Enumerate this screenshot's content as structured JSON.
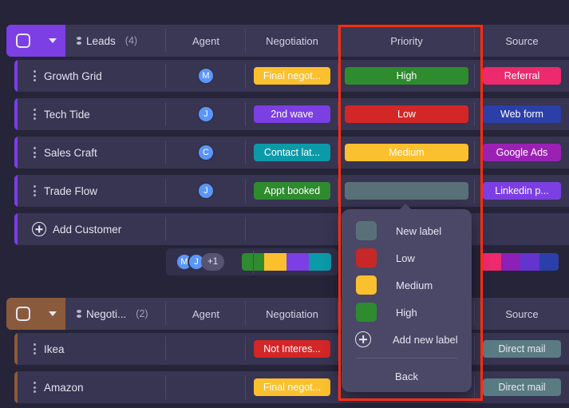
{
  "theme": {
    "page_bg": "#262438",
    "row_bg": "#373552",
    "header_bg": "#3a3855",
    "divider": "#4a4862",
    "annotation_color": "#ff2d10"
  },
  "annotation": {
    "name": "priority-column-highlight",
    "label": "Priority column highlight"
  },
  "tables": [
    {
      "id": "leads",
      "group_color": "#7b3fe4",
      "header": {
        "checkbox": "checkbox-icon",
        "chevron": "chevron-down-icon",
        "title": "Leads",
        "count": "(4)",
        "columns": [
          "Agent",
          "Negotiation",
          "Priority",
          "Source"
        ]
      },
      "rows": [
        {
          "name": "Growth Grid",
          "agent": {
            "initial": "M",
            "color": "#5b96f7"
          },
          "negotiation": {
            "label": "Final negot...",
            "color": "#fbc02d",
            "text_color": "#fff"
          },
          "priority": {
            "label": "High",
            "color": "#2e8b2e",
            "text_color": "#fff"
          },
          "source": {
            "label": "Referral",
            "color": "#ec2a6d",
            "text_color": "#fff"
          }
        },
        {
          "name": "Tech Tide",
          "agent": {
            "initial": "J",
            "color": "#5b96f7"
          },
          "negotiation": {
            "label": "2nd wave",
            "color": "#7b3fe4",
            "text_color": "#fff"
          },
          "priority": {
            "label": "Low",
            "color": "#d32626",
            "text_color": "#fff"
          },
          "source": {
            "label": "Web form",
            "color": "#2a3fa8",
            "text_color": "#fff"
          }
        },
        {
          "name": "Sales Craft",
          "agent": {
            "initial": "C",
            "color": "#5b96f7"
          },
          "negotiation": {
            "label": "Contact lat...",
            "color": "#0b9aa8",
            "text_color": "#fff"
          },
          "priority": {
            "label": "Medium",
            "color": "#fbc02d",
            "text_color": "#fff"
          },
          "source": {
            "label": "Google Ads",
            "color": "#9b21b5",
            "text_color": "#fff"
          }
        },
        {
          "name": "Trade Flow",
          "agent": {
            "initial": "J",
            "color": "#5b96f7"
          },
          "negotiation": {
            "label": "Appt booked",
            "color": "#2e8b2e",
            "text_color": "#fff"
          },
          "priority": {
            "label": "",
            "color": "#5a7078",
            "text_color": "#fff",
            "selected": true
          },
          "source": {
            "label": "Linkedin p...",
            "color": "#7b3fe4",
            "text_color": "#fff"
          }
        }
      ],
      "add_row": {
        "icon": "plus-circle-icon",
        "label": "Add Customer"
      },
      "summary": {
        "agents": [
          {
            "initial": "M",
            "color": "#5b96f7"
          },
          {
            "initial": "J",
            "color": "#5b96f7"
          }
        ],
        "overflow": "+1",
        "negotiation_dist": [
          {
            "color": "#2e8b2e",
            "width": 28
          },
          {
            "color": "#fbc02d",
            "width": 28
          },
          {
            "color": "#7b3fe4",
            "width": 28
          },
          {
            "color": "#0b9aa8",
            "width": 28
          }
        ],
        "source_dist": [
          {
            "color": "#ec2a6d",
            "width": 25
          },
          {
            "color": "#8b21b5",
            "width": 24
          },
          {
            "color": "#6434cf",
            "width": 24
          },
          {
            "color": "#2a3fa8",
            "width": 24
          }
        ]
      }
    },
    {
      "id": "negotiation",
      "group_color": "#8a5a3c",
      "header": {
        "checkbox": "checkbox-icon",
        "chevron": "chevron-down-icon",
        "title": "Negoti...",
        "count": "(2)",
        "columns": [
          "Agent",
          "Negotiation",
          "Priority",
          "Source"
        ]
      },
      "rows": [
        {
          "name": "Ikea",
          "agent": null,
          "negotiation": {
            "label": "Not Interes...",
            "color": "#d32626",
            "text_color": "#fff"
          },
          "priority": null,
          "source": {
            "label": "Direct mail",
            "color": "#5a7b82",
            "text_color": "#e8e8ee"
          }
        },
        {
          "name": "Amazon",
          "agent": null,
          "negotiation": {
            "label": "Final negot...",
            "color": "#fbc02d",
            "text_color": "#fff"
          },
          "priority": null,
          "source": {
            "label": "Direct mail",
            "color": "#5a7b82",
            "text_color": "#e8e8ee"
          }
        }
      ]
    }
  ],
  "dropdown": {
    "name": "label-picker-menu",
    "items": [
      {
        "label": "New label",
        "color": "#5a7078"
      },
      {
        "label": "Low",
        "color": "#c62828"
      },
      {
        "label": "Medium",
        "color": "#fbc02d"
      },
      {
        "label": "High",
        "color": "#2e8b2e"
      }
    ],
    "add_new": {
      "icon": "plus-circle-icon",
      "label": "Add new label"
    },
    "back": "Back"
  }
}
